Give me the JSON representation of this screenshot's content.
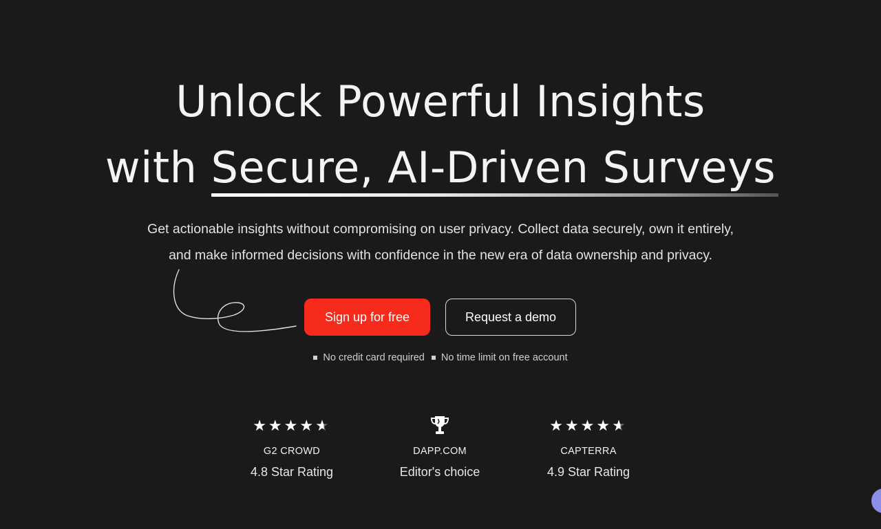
{
  "hero": {
    "headline_line1": "Unlock Powerful Insights",
    "headline_line2_prefix": "with ",
    "headline_line2_highlight": "Secure, AI-Driven Surveys",
    "subtitle_line1": "Get actionable insights without compromising on user privacy. Collect data securely, own it entirely,",
    "subtitle_line2": "and make informed decisions with confidence in the new era of data ownership and privacy."
  },
  "cta": {
    "primary_label": "Sign up for free",
    "secondary_label": "Request a demo",
    "accent_color": "#f72b1b"
  },
  "notes": [
    "No credit card required",
    "No time limit on free account"
  ],
  "ratings": [
    {
      "icon": "stars-icon",
      "stars": 4.5,
      "name": "G2 CROWD",
      "desc": "4.8 Star Rating"
    },
    {
      "icon": "trophy-icon",
      "name": "DAPP.COM",
      "desc": "Editor's choice"
    },
    {
      "icon": "stars-icon",
      "stars": 4.5,
      "name": "CAPTERRA",
      "desc": "4.9 Star Rating"
    }
  ],
  "colors": {
    "background": "#1b1a1b",
    "chat_bubble": "#8b8fe8"
  }
}
